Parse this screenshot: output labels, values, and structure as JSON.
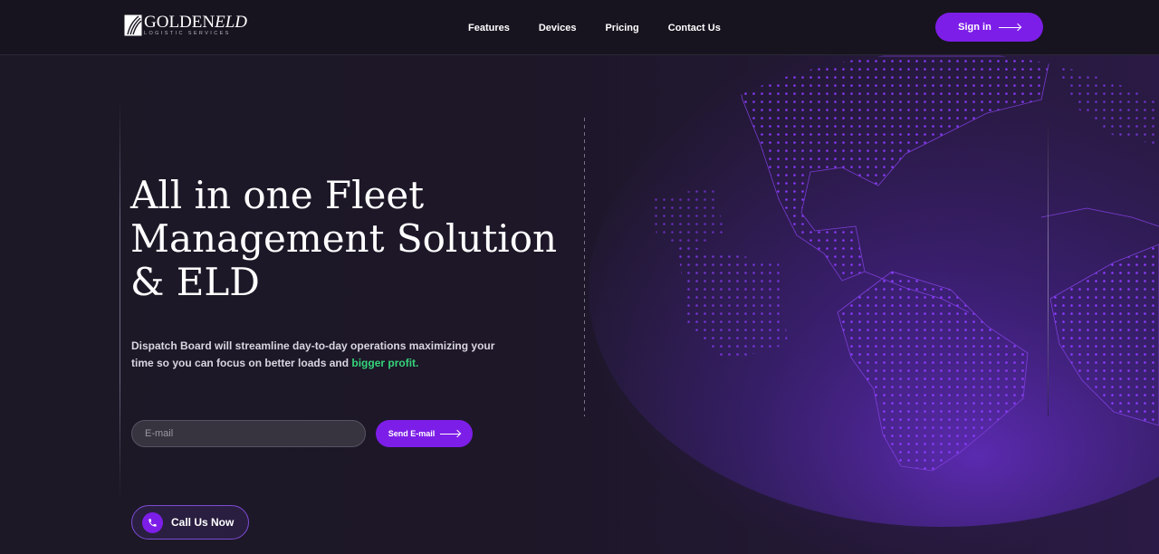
{
  "brand": {
    "name_main": "GOLDEN",
    "name_accent": "ELD",
    "tagline": "LOGISTIC SERVICES"
  },
  "nav": {
    "items": [
      {
        "label": "Features"
      },
      {
        "label": "Devices"
      },
      {
        "label": "Pricing"
      },
      {
        "label": "Contact Us"
      }
    ],
    "signin_label": "Sign in"
  },
  "hero": {
    "title_line1": "All in one Fleet",
    "title_line2": "Management Solution",
    "title_line3": "& ELD",
    "subtitle_text": "Dispatch Board will streamline day-to-day operations maximizing your time so you can focus on better loads and ",
    "subtitle_highlight": "bigger profit."
  },
  "signup": {
    "email_placeholder": "E-mail",
    "email_value": "",
    "send_label": "Send E-mail"
  },
  "call": {
    "label": "Call Us Now"
  },
  "colors": {
    "accent": "#7d1ee8",
    "highlight": "#35d47a",
    "background": "#1d1827",
    "header": "#17141f"
  },
  "icons": {
    "logo": "logo-mark-icon",
    "signin_arrow": "arrow-right-icon",
    "send_arrow": "arrow-right-icon",
    "call": "phone-icon"
  }
}
